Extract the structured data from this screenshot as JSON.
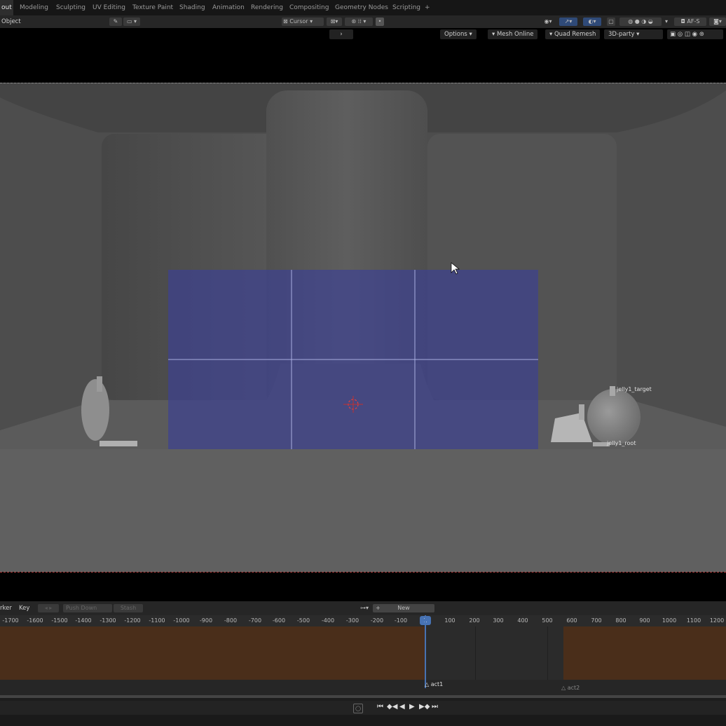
{
  "workspace_tabs": [
    {
      "label": "out",
      "active": true
    },
    {
      "label": "Modeling"
    },
    {
      "label": "Sculpting"
    },
    {
      "label": "UV Editing"
    },
    {
      "label": "Texture Paint"
    },
    {
      "label": "Shading"
    },
    {
      "label": "Animation"
    },
    {
      "label": "Rendering"
    },
    {
      "label": "Compositing"
    },
    {
      "label": "Geometry Nodes"
    },
    {
      "label": "Scripting"
    },
    {
      "label": "+"
    }
  ],
  "header": {
    "mode": "Object",
    "pivot": "Cursor",
    "camera_label": "AF-S"
  },
  "viewport_header": {
    "options": "Options",
    "mesh_online": "Mesh Online",
    "quad_remesh": "Quad Remesh",
    "party": "3D-party"
  },
  "scene": {
    "target_label": "jelly1_target",
    "root_label": "jelly1_root",
    "selection_color": "#3a3f9a"
  },
  "timeline": {
    "marker_menu": "rker",
    "key_menu": "Key",
    "push_down": "Push Down",
    "stash": "Stash",
    "new_button": "New",
    "current_frame": "1",
    "ticks": [
      "-1700",
      "-1600",
      "-1500",
      "-1400",
      "-1300",
      "-1200",
      "-1100",
      "-1000",
      "-900",
      "-800",
      "-700",
      "-600",
      "-500",
      "-400",
      "-300",
      "-200",
      "-100",
      "100",
      "200",
      "300",
      "400",
      "500",
      "600",
      "700",
      "800",
      "900",
      "1000",
      "1100",
      "1200"
    ],
    "action1": "act1",
    "action2": "act2",
    "strip_color": "#4a2e1a"
  }
}
